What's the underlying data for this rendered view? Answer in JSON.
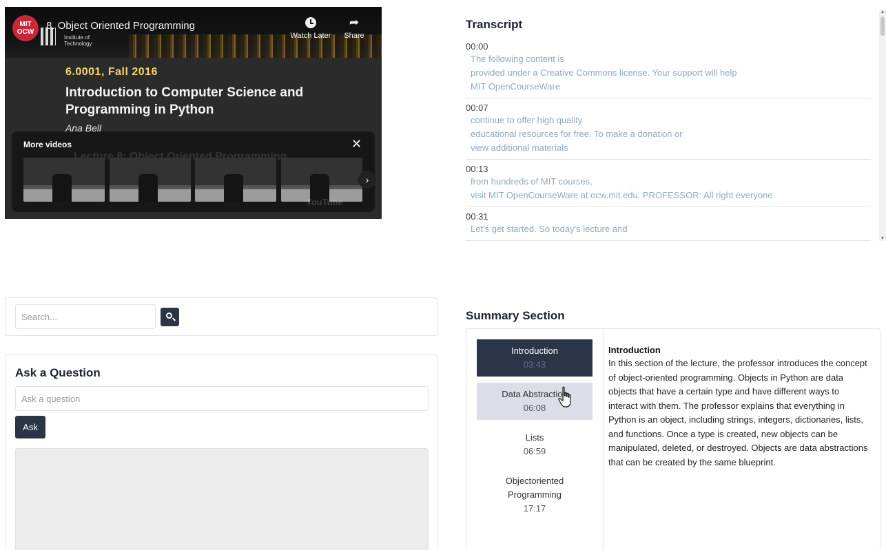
{
  "video": {
    "badge_line1": "MIT",
    "badge_line2": "OCW",
    "title": "8. Object Oriented Programming",
    "institute_line1": "Institute of",
    "institute_line2": "Technology",
    "watch_later_label": "Watch Later",
    "share_label": "Share",
    "course_code": "6.0001, Fall 2016",
    "course_title": "Introduction to Computer Science and Programming in Python",
    "course_author": "Ana Bell",
    "more_videos_label": "More videos",
    "close_glyph": "✕",
    "next_glyph": "›",
    "behind_text": "Lecture 8: Object Oriented Programming",
    "watermark": "YouTube"
  },
  "transcript": {
    "title": "Transcript",
    "entries": [
      {
        "time": "00:00",
        "lines": [
          "The following content is",
          "provided under a Creative Commons license. Your support will help",
          "MIT OpenCourseWare"
        ]
      },
      {
        "time": "00:07",
        "lines": [
          "continue to offer high quality",
          "educational resources for free. To make a donation or",
          "view additional materials"
        ]
      },
      {
        "time": "00:13",
        "lines": [
          "from hundreds of MIT courses,",
          "visit MIT OpenCourseWare at ocw.mit.edu. PROFESSOR: All right everyone."
        ]
      },
      {
        "time": "00:31",
        "lines": [
          "Let's get started. So today's lecture and"
        ]
      }
    ]
  },
  "search": {
    "placeholder": "Search..."
  },
  "ask": {
    "title": "Ask a Question",
    "placeholder": "Ask a question",
    "button_label": "Ask"
  },
  "summary": {
    "title": "Summary Section",
    "sections": [
      {
        "name": "Introduction",
        "time": "03:43",
        "active": true
      },
      {
        "name": "Data Abstraction",
        "time": "06:08",
        "active": false
      },
      {
        "name": "Lists",
        "time": "06:59",
        "active": false
      },
      {
        "name": "Objectoriented Programming",
        "time": "17:17",
        "active": false
      }
    ],
    "content_heading": "Introduction",
    "content_text": "In this section of the lecture, the professor introduces the concept of object-oriented programming. Objects in Python are data objects that have a certain type and have different ways to interact with them. The professor explains that everything in Python is an object, including strings, integers, dictionaries, lists, and functions. Once a type is created, new objects can be manipulated, deleted, or destroyed. Objects are data abstractions that can be created by the same blueprint."
  }
}
